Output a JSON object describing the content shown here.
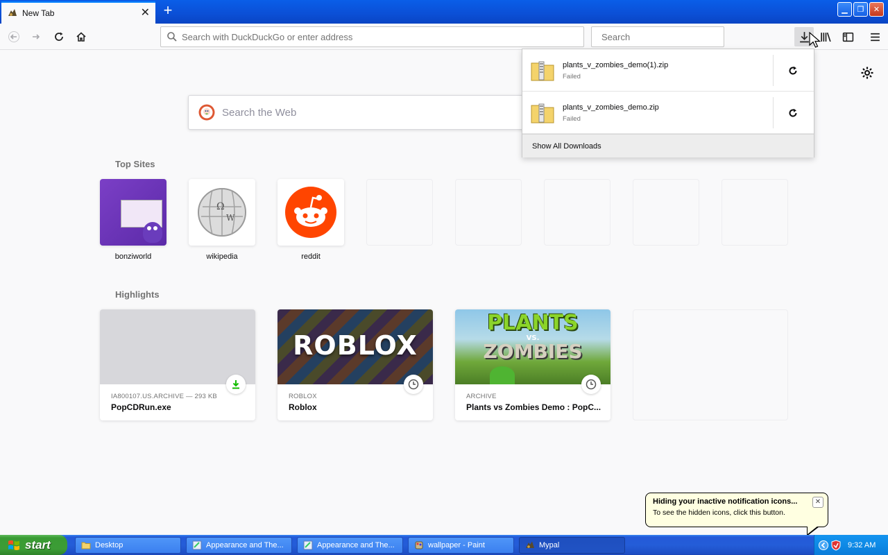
{
  "browser": {
    "tab": {
      "title": "New Tab",
      "favicon": "mypal-icon"
    },
    "newtab_icon": "plus-icon",
    "urlbar": {
      "placeholder": "Search with DuckDuckGo or enter address",
      "value": ""
    },
    "searchbar": {
      "placeholder": "Search",
      "value": ""
    }
  },
  "newtab": {
    "websearch_placeholder": "Search the Web",
    "topsites_title": "Top Sites",
    "topsites": [
      {
        "label": "bonziworld"
      },
      {
        "label": "wikipedia"
      },
      {
        "label": "reddit"
      },
      {
        "label": ""
      },
      {
        "label": ""
      },
      {
        "label": ""
      },
      {
        "label": ""
      },
      {
        "label": ""
      }
    ],
    "highlights_title": "Highlights",
    "highlights": [
      {
        "source": "IA800107.US.ARCHIVE — 293 KB",
        "title": "PopCDRun.exe",
        "badge": "download-icon"
      },
      {
        "source": "ROBLOX",
        "title": "Roblox",
        "badge": "clock-icon",
        "image_text": "ROBLOX"
      },
      {
        "source": "ARCHIVE",
        "title": "Plants vs Zombies Demo : PopC...",
        "badge": "clock-icon",
        "image_text_top": "PLANTS",
        "image_text_vs": "VS.",
        "image_text_bottom": "ZOMBIES"
      }
    ]
  },
  "downloads": {
    "items": [
      {
        "name": "plants_v_zombies_demo(1).zip",
        "status": "Failed"
      },
      {
        "name": "plants_v_zombies_demo.zip",
        "status": "Failed"
      }
    ],
    "show_all": "Show All Downloads"
  },
  "balloon": {
    "title": "Hiding your inactive notification icons...",
    "text": "To see the hidden icons, click this button.",
    "close": "✕"
  },
  "taskbar": {
    "start": "start",
    "buttons": [
      {
        "label": "Desktop",
        "icon": "folder-icon"
      },
      {
        "label": "Appearance and The...",
        "icon": "control-panel-icon"
      },
      {
        "label": "Appearance and The...",
        "icon": "control-panel-icon"
      },
      {
        "label": "wallpaper - Paint",
        "icon": "paint-icon"
      },
      {
        "label": "Mypal",
        "icon": "mypal-icon"
      }
    ],
    "clock": "9:32 AM"
  },
  "colors": {
    "accent": "#0a84ff",
    "taskbar": "#245dd8",
    "start": "#3c9c36",
    "failed": "#737373"
  }
}
